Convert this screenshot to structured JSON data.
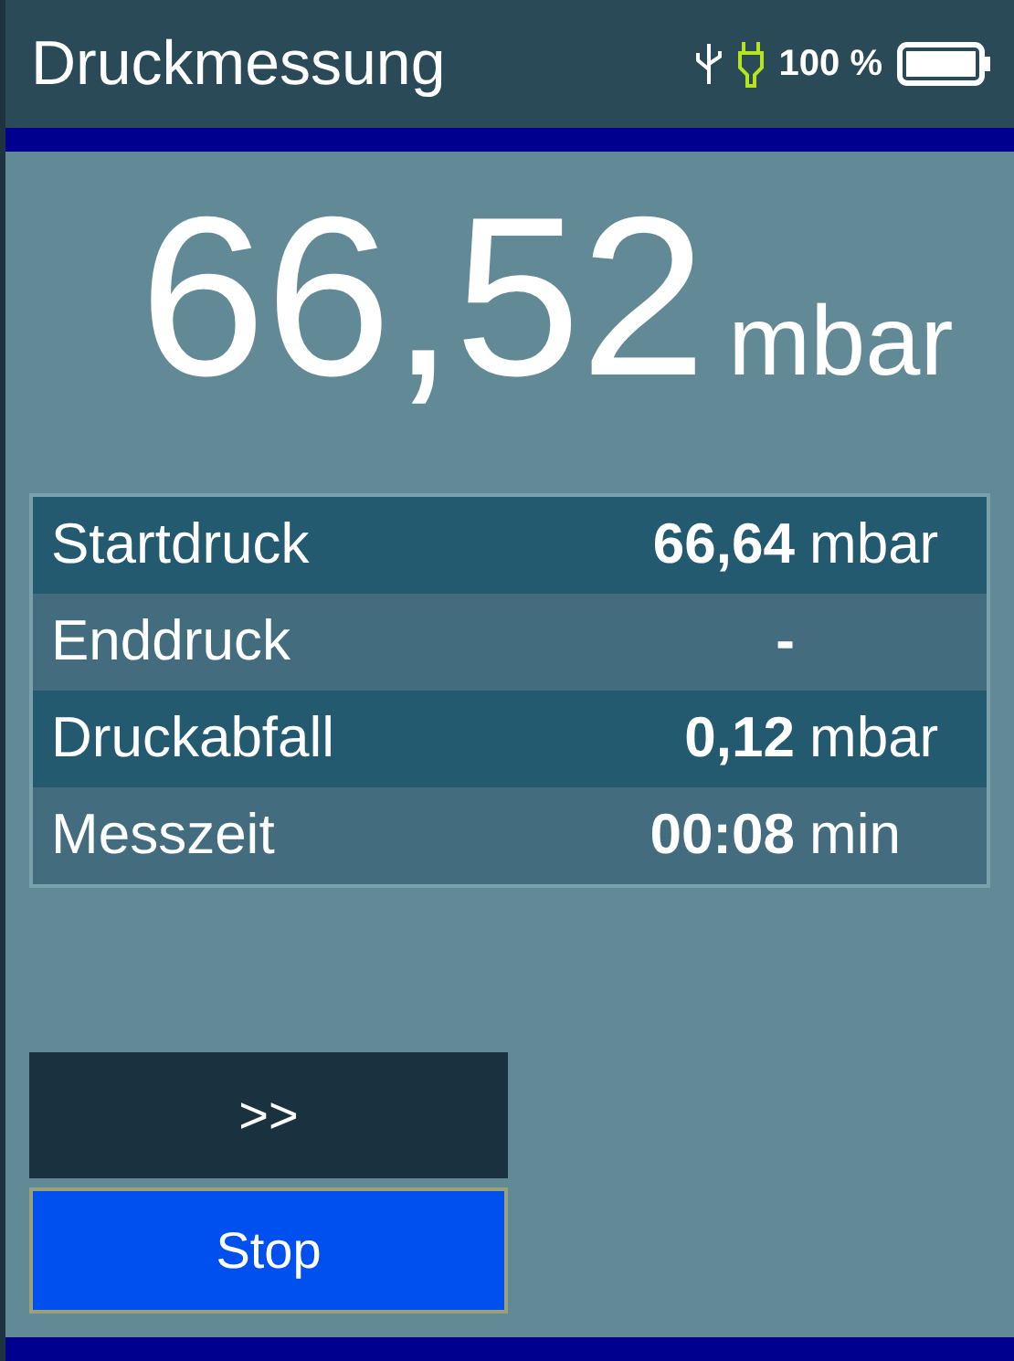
{
  "header": {
    "title": "Druckmessung",
    "battery_text": "100 %"
  },
  "reading": {
    "value": "66,52",
    "unit": "mbar"
  },
  "rows": [
    {
      "label": "Startdruck",
      "value": "66,64",
      "unit": "mbar"
    },
    {
      "label": "Enddruck",
      "value": "-"
    },
    {
      "label": "Druckabfall",
      "value": "0,12",
      "unit": "mbar"
    },
    {
      "label": "Messzeit",
      "value": "00:08",
      "unit": "min"
    }
  ],
  "buttons": [
    {
      "label": ">>",
      "selected": false
    },
    {
      "label": "Stop",
      "selected": true
    }
  ]
}
